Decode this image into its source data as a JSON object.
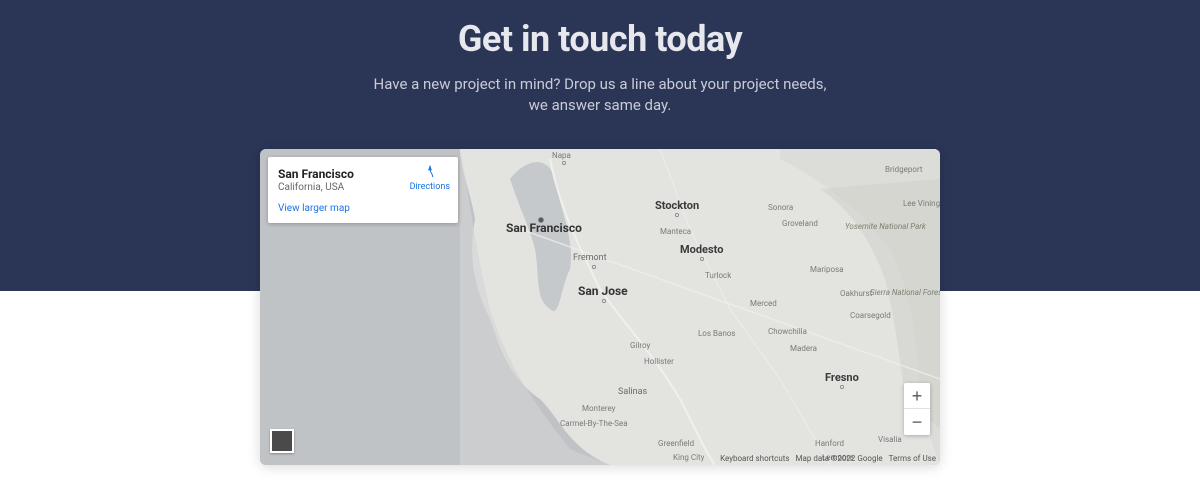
{
  "hero": {
    "title": "Get in touch today",
    "subtitle": "Have a new project in mind? Drop us a line about your project needs, we answer same day."
  },
  "map": {
    "info": {
      "title": "San Francisco",
      "subtitle": "California, USA",
      "view_larger": "View larger map",
      "directions": "Directions"
    },
    "attribution": {
      "shortcuts": "Keyboard shortcuts",
      "data": "Map data ©2022 Google",
      "terms": "Terms of Use"
    },
    "labels": {
      "napa": "Napa",
      "stockton": "Stockton",
      "san_francisco": "San Francisco",
      "fremont": "Fremont",
      "san_jose": "San Jose",
      "modesto": "Modesto",
      "fresno": "Fresno",
      "sonora": "Sonora",
      "groveland": "Groveland",
      "manteca": "Manteca",
      "turlock": "Turlock",
      "merced": "Merced",
      "mariposa": "Mariposa",
      "oakhurst": "Oakhurst",
      "coarsegold": "Coarsegold",
      "chowchilla": "Chowchilla",
      "madera": "Madera",
      "los_banos": "Los Banos",
      "gilroy": "Gilroy",
      "hollister": "Hollister",
      "salinas": "Salinas",
      "monterey": "Monterey",
      "carmel": "Carmel-By-The-Sea",
      "greenfield": "Greenfield",
      "king_city": "King City",
      "hanford": "Hanford",
      "visalia": "Visalia",
      "lemoore": "Lemoore",
      "bridgeport": "Bridgeport",
      "lee_vining": "Lee Vining",
      "yosemite": "Yosemite National Park",
      "sierra_forest": "Sierra National Forest"
    }
  }
}
